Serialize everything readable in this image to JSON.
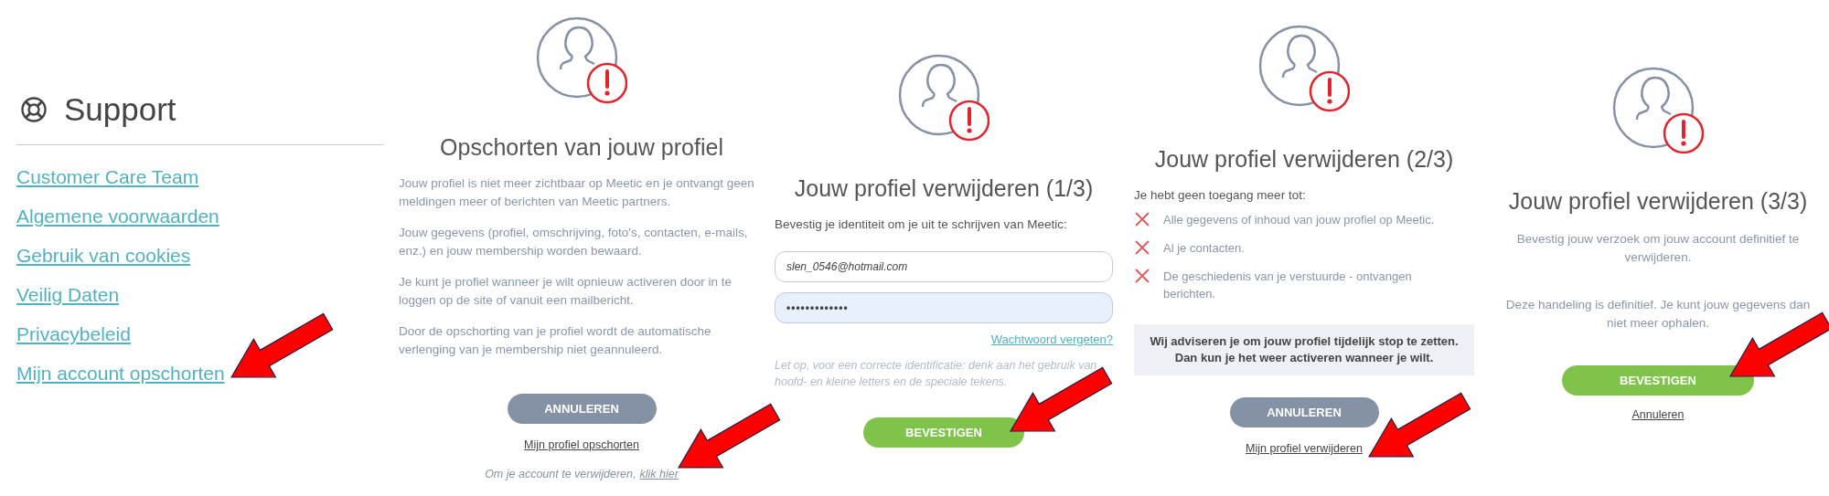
{
  "support": {
    "title": "Support",
    "links": [
      "Customer Care Team",
      "Algemene voorwaarden",
      "Gebruik van cookies",
      "Veilig Daten",
      "Privacybeleid",
      "Mijn account opschorten"
    ]
  },
  "suspend_screen": {
    "title": "Opschorten van jouw profiel",
    "paragraphs": [
      "Jouw profiel is niet meer zichtbaar op Meetic en je ontvangt geen meldingen meer of berichten van Meetic partners.",
      "Jouw gegevens (profiel, omschrijving, foto's, contacten, e-mails, enz.) en jouw membership worden bewaard.",
      "Je kunt je profiel wanneer je wilt opnieuw activeren door in te loggen op de site of vanuit een mailbericht.",
      "Door de opschorting van je profiel wordt de automatische verlenging van je membership niet geannuleerd."
    ],
    "cancel_button": "ANNULEREN",
    "suspend_link": "Mijn profiel opschorten",
    "delete_note": "Om je account te verwijderen,",
    "delete_link": "klik hier"
  },
  "delete_step_1": {
    "title": "Jouw profiel verwijderen (1/3)",
    "instruction": "Bevestig je identiteit om je uit te schrijven van Meetic:",
    "email_field": {
      "value": "slen_0546@hotmail.com"
    },
    "password_field": {
      "value": "•••••••••••••"
    },
    "forgot_link": "Wachtwoord vergeten?",
    "hint": "Let op, voor een correcte identificatie: denk aan het gebruik van hoofd- en kleine letters en de speciale tekens.",
    "confirm_button": "BEVESTIGEN"
  },
  "delete_step_2": {
    "title": "Jouw profiel verwijderen (2/3)",
    "intro": "Je hebt geen toegang meer tot:",
    "lost_items": [
      "Alle gegevens of inhoud van jouw profiel op Meetic.",
      "Al je contacten.",
      "De geschiedenis van je verstuurde - ontvangen berichten."
    ],
    "advice": "Wij adviseren je om jouw profiel tijdelijk stop te zetten. Dan kun je het weer activeren wanneer je wilt.",
    "cancel_button": "ANNULEREN",
    "delete_link": "Mijn profiel verwijderen"
  },
  "delete_step_3": {
    "title": "Jouw profiel verwijderen (3/3)",
    "paragraphs": [
      "Bevestig jouw verzoek om jouw account definitief te verwijderen.",
      "Deze handeling is definitief. Je kunt jouw gegevens dan niet meer ophalen."
    ],
    "confirm_button": "BEVESTIGEN",
    "cancel_link": "Annuleren"
  }
}
